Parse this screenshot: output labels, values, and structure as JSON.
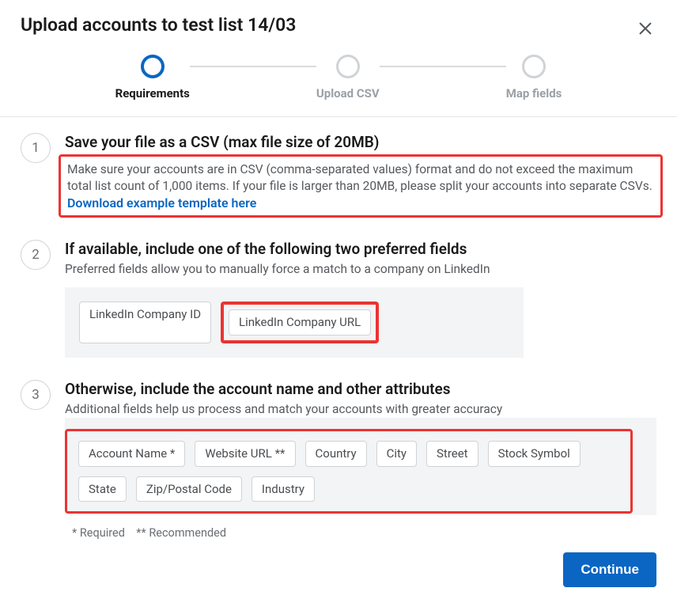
{
  "title": "Upload accounts to test list 14/03",
  "stepper": {
    "steps": [
      {
        "label": "Requirements",
        "active": true
      },
      {
        "label": "Upload CSV",
        "active": false
      },
      {
        "label": "Map fields",
        "active": false
      }
    ]
  },
  "section1": {
    "num": "1",
    "title": "Save your file as a CSV (max file size of 20MB)",
    "desc": "Make sure your accounts are in CSV (comma-separated values) format and do not exceed the maximum total list count of 1,000 items. If your file is larger than 20MB, please split your accounts into separate CSVs. ",
    "link": "Download example template here"
  },
  "section2": {
    "num": "2",
    "title": "If available, include one of the following two preferred fields",
    "desc": "Preferred fields allow you to manually force a match to a company on LinkedIn",
    "chips": [
      "LinkedIn Company ID",
      "LinkedIn Company URL"
    ]
  },
  "section3": {
    "num": "3",
    "title": "Otherwise, include the account name and other attributes",
    "desc": "Additional fields help us process and match your accounts with greater accuracy",
    "chips": [
      "Account Name *",
      "Website URL **",
      "Country",
      "City",
      "Street",
      "Stock Symbol",
      "State",
      "Zip/Postal Code",
      "Industry"
    ]
  },
  "legend": "* Required    ** Recommended",
  "footer": {
    "continue_label": "Continue"
  }
}
